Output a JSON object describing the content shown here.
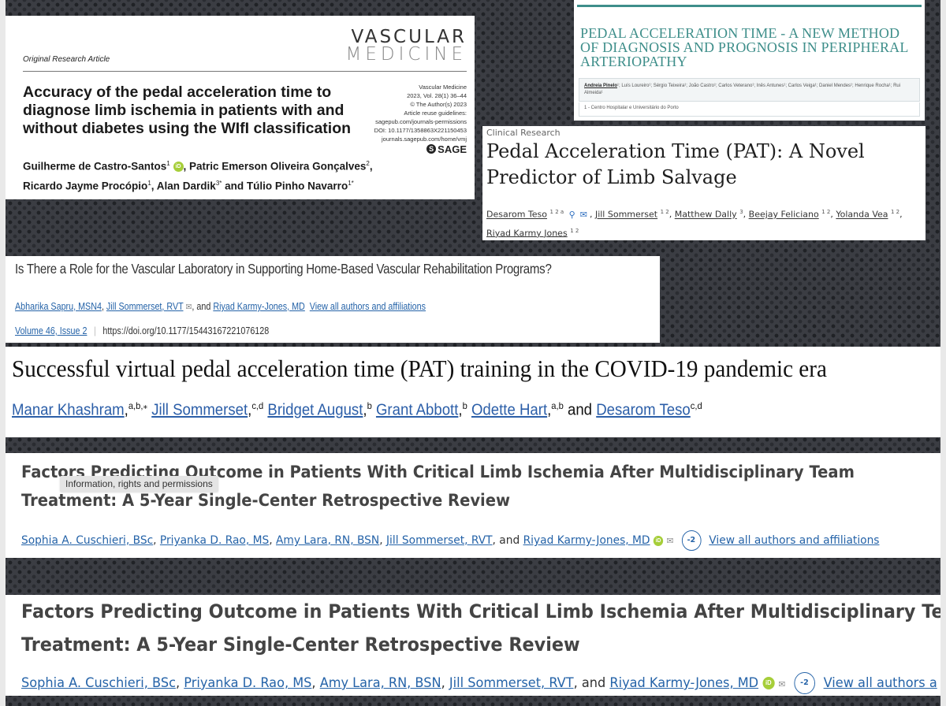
{
  "panel_vascmed": {
    "article_type": "Original Research Article",
    "journal_logo_line1": "VASCULAR",
    "journal_logo_line2": "MEDICINE",
    "title": "Accuracy of the pedal acceleration time to diagnose limb ischemia in patients with and without diabetes using the WIfI classification",
    "meta": [
      "Vascular Medicine",
      "2023, Vol. 28(1) 36–44",
      "© The Author(s) 2023",
      "Article reuse guidelines:",
      "sagepub.com/journals-permissions",
      "DOI: 10.1177/1358863X221150453",
      "journals.sagepub.com/home/vmj"
    ],
    "publisher": "SAGE",
    "authors": [
      {
        "name": "Guilherme de Castro-Santos",
        "sup": "1",
        "orcid": true
      },
      {
        "name": "Patric Emerson Oliveira Gonçalves",
        "sup": "2"
      },
      {
        "name": "Ricardo Jayme Procópio",
        "sup": "1"
      },
      {
        "name": "Alan Dardik",
        "sup": "3*"
      },
      {
        "name": "Túlio Pinho Navarro",
        "sup": "1*"
      }
    ],
    "authors_join": "and"
  },
  "panel_porto": {
    "title": "PEDAL ACCELERATION TIME - A NEW METHOD OF DIAGNOSIS AND PROGNOSIS IN PERIPHERAL ARTERIOPATHY",
    "authors_first": "Andreia Pinelo",
    "authors_rest": "¹; Luís Loureiro¹; Sérgio Teixeira¹; João Castro¹; Carlos Veterano¹; Inês Antunes¹; Carlos Veiga¹; Daniel Mendes¹; Henrique Rocha¹; Rui Almeida¹",
    "affiliation": "1 - Centro Hospitalar e Universitário do Porto"
  },
  "panel_clinical": {
    "kicker": "Clinical Research",
    "title": "Pedal Acceleration Time (PAT): A Novel Predictor of Limb Salvage",
    "authors": [
      {
        "name": "Desarom Teso",
        "sup": "1 2 a"
      },
      {
        "name": "Jill Sommerset",
        "sup": "1 2"
      },
      {
        "name": "Matthew Dally",
        "sup": "3"
      },
      {
        "name": "Beejay Feliciano",
        "sup": "1 2"
      },
      {
        "name": "Yolanda Vea",
        "sup": "1 2"
      },
      {
        "name": "Riyad Karmy Jones",
        "sup": "1 2"
      }
    ]
  },
  "panel_rehab": {
    "title": "Is There a Role for the Vascular Laboratory in Supporting Home-Based Vascular Rehabilitation Programs?",
    "authors": [
      "Abharika Sapru, MSN4",
      "Jill Sommerset, RVT",
      "Riyad Karmy-Jones, MD"
    ],
    "and": ", and",
    "view_all": "View all authors and affiliations",
    "volume": "Volume 46, Issue 2",
    "doi": "https://doi.org/10.1177/15443167221076128"
  },
  "panel_covid": {
    "title": "Successful virtual pedal acceleration time (PAT) training in the COVID-19 pandemic era",
    "authors": [
      {
        "name": "Manar Khashram",
        "sup": "a,b,⁎"
      },
      {
        "name": "Jill Sommerset",
        "sup": "c,d"
      },
      {
        "name": "Bridget August",
        "sup": "b"
      },
      {
        "name": "Grant Abbott",
        "sup": "b"
      },
      {
        "name": "Odette Hart",
        "sup": "a,b"
      },
      {
        "name": "Desarom Teso",
        "sup": "c,d"
      }
    ],
    "and": "and"
  },
  "panel_cli": {
    "title_line1": "Factors Predicting Outcome in Patients With Critical Limb Ischemia After Multidisciplinary Team",
    "title_line2": "Treatment: A 5-Year Single-Center Retrospective Review",
    "authors": [
      "Sophia A. Cuschieri, BSc",
      "Priyanka D. Rao, MS",
      "Amy Lara, RN, BSN",
      "Jill Sommerset, RVT",
      "Riyad Karmy-Jones, MD"
    ],
    "and": "and",
    "more_count": "-2",
    "view_all": "View all authors and affiliations",
    "view_all_truncated": "View all authors a",
    "tooltip": "Information, rights and permissions"
  },
  "icons": {
    "orcid": "iD",
    "mail": "✉",
    "person": "⚲",
    "sage_mark": "S"
  }
}
